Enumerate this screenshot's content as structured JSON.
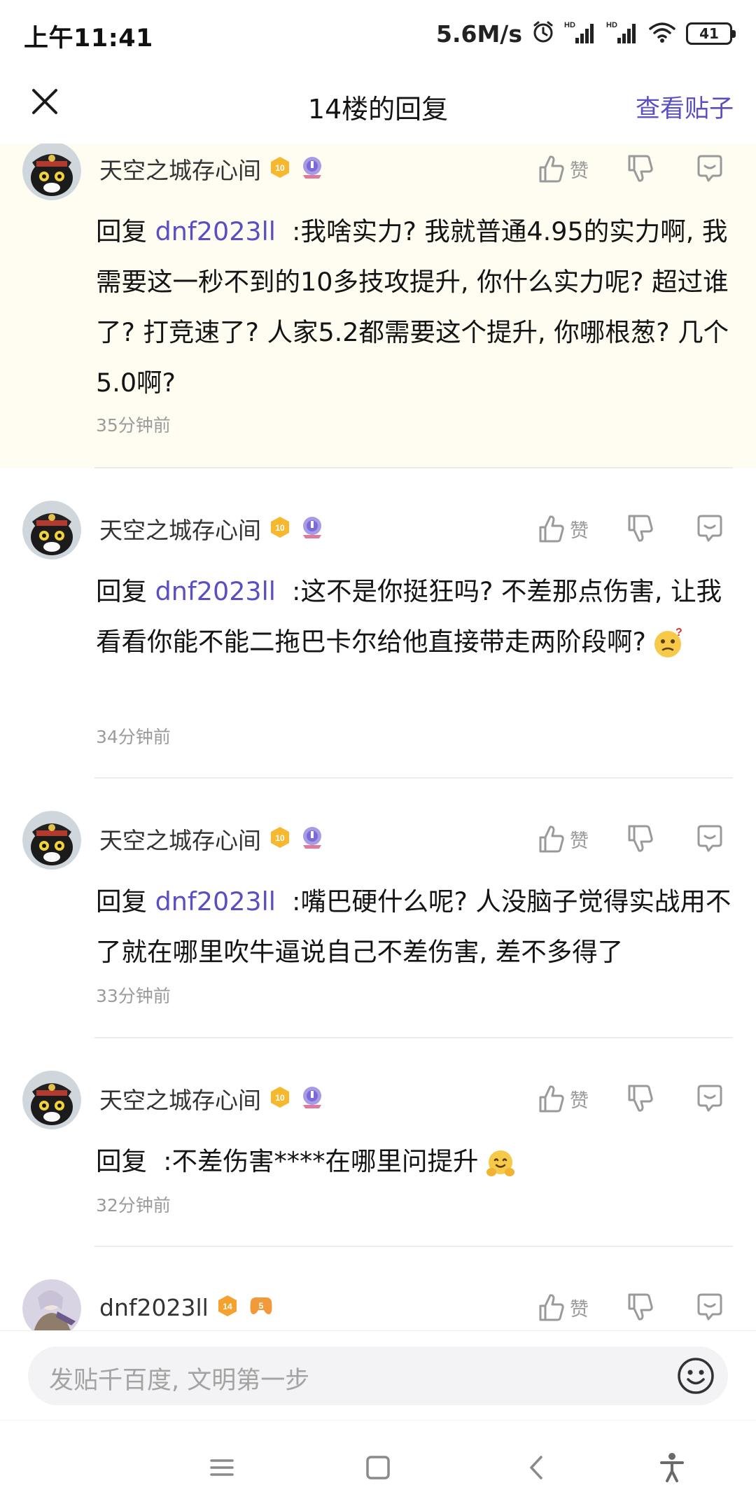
{
  "status_bar": {
    "time": "上午11:41",
    "net_speed": "5.6M/s",
    "battery": "41"
  },
  "nav": {
    "title": "14楼的回复",
    "view_post": "查看贴子"
  },
  "like_label": "赞",
  "colors": {
    "accent": "#5a4fc2",
    "highlight_bg": "#fffdf2",
    "level_badge": "#f5b82e",
    "divider": "#ececec"
  },
  "replies": [
    {
      "username": "天空之城存心间",
      "level": "10",
      "prefix": "回复",
      "mention": "dnf2023ll",
      "text": ":我啥实力? 我就普通4.95的实力啊, 我需要这一秒不到的10多技攻提升, 你什么实力呢? 超过谁了? 打竞速了? 人家5.2都需要这个提升, 你哪根葱? 几个5.0啊?",
      "time": "35分钟前"
    },
    {
      "username": "天空之城存心间",
      "level": "10",
      "prefix": "回复",
      "mention": "dnf2023ll",
      "text": ":这不是你挺狂吗? 不差那点伤害, 让我看看你能不能二拖巴卡尔给他直接带走两阶段啊?",
      "emoji": "thinking-face-icon",
      "time": "34分钟前"
    },
    {
      "username": "天空之城存心间",
      "level": "10",
      "prefix": "回复",
      "mention": "dnf2023ll",
      "text": ":嘴巴硬什么呢? 人没脑子觉得实战用不了就在哪里吹牛逼说自己不差伤害, 差不多得了",
      "time": "33分钟前"
    },
    {
      "username": "天空之城存心间",
      "level": "10",
      "prefix": "回复",
      "mention": "",
      "text": ":不差伤害****在哪里问提升",
      "emoji": "hugging-face-icon",
      "time": "32分钟前"
    },
    {
      "username": "dnf2023ll",
      "level": "14",
      "badge2": "5"
    }
  ],
  "input": {
    "placeholder": "发贴千百度, 文明第一步"
  }
}
